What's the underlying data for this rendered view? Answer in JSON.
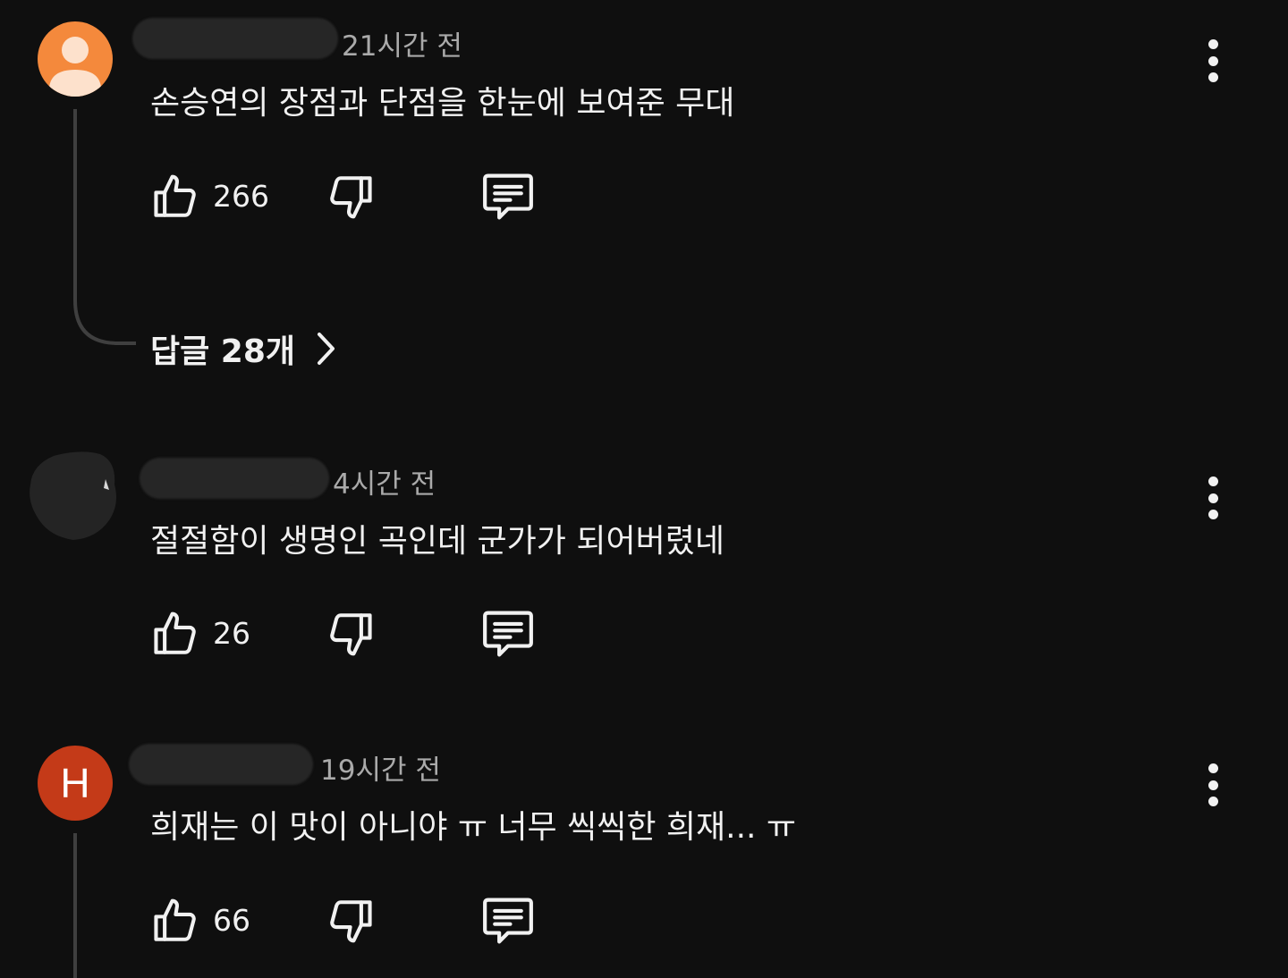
{
  "comments": [
    {
      "timestamp": "21시간 전",
      "text": "손승연의 장점과 단점을 한눈에 보여준 무대",
      "likes": "266",
      "replies_label": "답글 28개",
      "avatar": "person-icon"
    },
    {
      "timestamp": "4시간 전",
      "text": "절절함이 생명인 곡인데 군가가 되어버렸네",
      "likes": "26"
    },
    {
      "timestamp": "19시간 전",
      "text": "희재는 이 맛이 아니야 ㅠ 너무 씩씩한 희재... ㅠ",
      "likes": "66",
      "avatar_letter": "H"
    }
  ],
  "colors": {
    "background": "#0f0f0f",
    "avatar_orange": "#f4893c",
    "avatar_red": "#c43a18",
    "text": "#f1f1f1",
    "muted": "#aaaaaa"
  }
}
